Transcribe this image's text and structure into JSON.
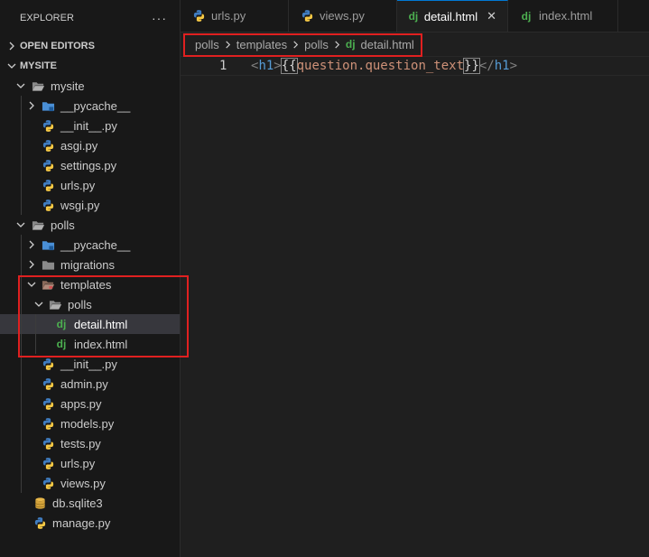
{
  "explorer": {
    "title": "EXPLORER",
    "more": "···",
    "open_editors": "OPEN EDITORS",
    "root": "MYSITE"
  },
  "tree": {
    "mysite": "mysite",
    "mysite_pycache": "__pycache__",
    "mysite_init": "__init__.py",
    "asgi": "asgi.py",
    "settings": "settings.py",
    "mysite_urls": "urls.py",
    "wsgi": "wsgi.py",
    "polls": "polls",
    "polls_pycache": "__pycache__",
    "migrations": "migrations",
    "templates": "templates",
    "templates_polls": "polls",
    "detail": "detail.html",
    "index": "index.html",
    "polls_init": "__init__.py",
    "admin": "admin.py",
    "apps": "apps.py",
    "models": "models.py",
    "tests": "tests.py",
    "polls_urls": "urls.py",
    "views": "views.py",
    "db": "db.sqlite3",
    "manage": "manage.py"
  },
  "tabs": {
    "urls": "urls.py",
    "views": "views.py",
    "detail": "detail.html",
    "index": "index.html",
    "close": "✕"
  },
  "breadcrumb": {
    "c1": "polls",
    "c2": "templates",
    "c3": "polls",
    "c4": "detail.html"
  },
  "editor": {
    "line_number": "1",
    "t_open_lt": "<",
    "t_open_name": "h1",
    "t_open_gt": ">",
    "brace_open": "{{",
    "expr": "question.question_text",
    "brace_close": "}}",
    "t_close_lt": "</",
    "t_close_name": "h1",
    "t_close_gt": ">"
  },
  "icon_labels": {
    "django": "dj"
  },
  "colors": {
    "python_blue": "#3f7cc0",
    "python_yellow": "#f6c945",
    "django_green": "#4caf50",
    "highlight_red": "#e02020",
    "accent": "#0078d4"
  }
}
